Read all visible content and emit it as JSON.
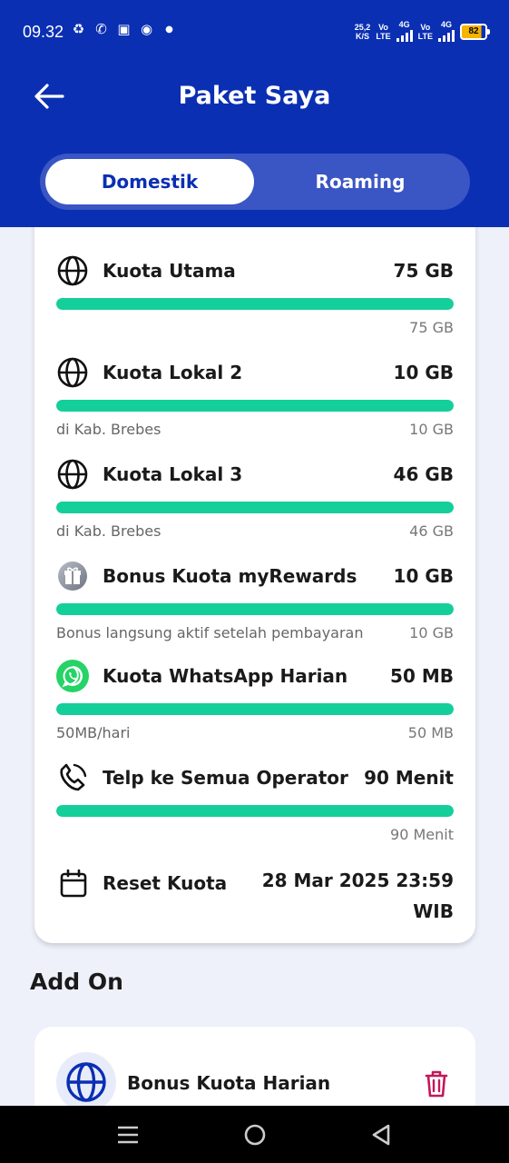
{
  "status_bar": {
    "time": "09.32",
    "net_speed_top": "25,2",
    "net_speed_bottom": "K/S",
    "sim1_top": "Vo",
    "sim1_bottom": "LTE",
    "sim1_gen": "4G",
    "sim2_top": "Vo",
    "sim2_bottom": "LTE",
    "sim2_gen": "4G",
    "battery": "82",
    "battery_level": 0.82
  },
  "header": {
    "title": "Paket Saya",
    "back_icon": "arrow-left-icon"
  },
  "tabs": [
    {
      "label": "Domestik",
      "active": true
    },
    {
      "label": "Roaming",
      "active": false
    }
  ],
  "quota_items": [
    {
      "icon": "globe-icon",
      "name": "Kuota Utama",
      "amount": "75 GB",
      "subtitle": "",
      "remaining": "75 GB",
      "fill_fraction": 1.0
    },
    {
      "icon": "globe-icon",
      "name": "Kuota Lokal 2",
      "amount": "10 GB",
      "subtitle": "di Kab. Brebes",
      "remaining": "10 GB",
      "fill_fraction": 1.0
    },
    {
      "icon": "globe-icon",
      "name": "Kuota Lokal 3",
      "amount": "46 GB",
      "subtitle": "di Kab. Brebes",
      "remaining": "46 GB",
      "fill_fraction": 1.0
    },
    {
      "icon": "gift-icon",
      "name": "Bonus Kuota myRewards",
      "amount": "10 GB",
      "subtitle": "Bonus langsung aktif setelah pembayaran",
      "remaining": "10 GB",
      "fill_fraction": 1.0
    },
    {
      "icon": "whatsapp-icon",
      "name": "Kuota WhatsApp Harian",
      "amount": "50 MB",
      "subtitle": "50MB/hari",
      "remaining": "50 MB",
      "fill_fraction": 1.0
    },
    {
      "icon": "phone-icon",
      "name": "Telp ke Semua Operator",
      "amount": "90 Menit",
      "subtitle": "",
      "remaining": "90 Menit",
      "fill_fraction": 1.0
    }
  ],
  "reset": {
    "icon": "calendar-icon",
    "label": "Reset Kuota",
    "date": "28 Mar 2025 23:59 WIB"
  },
  "addon": {
    "section_title": "Add On",
    "items": [
      {
        "icon": "globe-icon",
        "name": "Bonus Kuota Harian",
        "action_icon": "trash-icon"
      }
    ]
  },
  "colors": {
    "header_blue": "#0a2fb3",
    "progress_green": "#14cf9a",
    "trash_red": "#c2185b"
  }
}
